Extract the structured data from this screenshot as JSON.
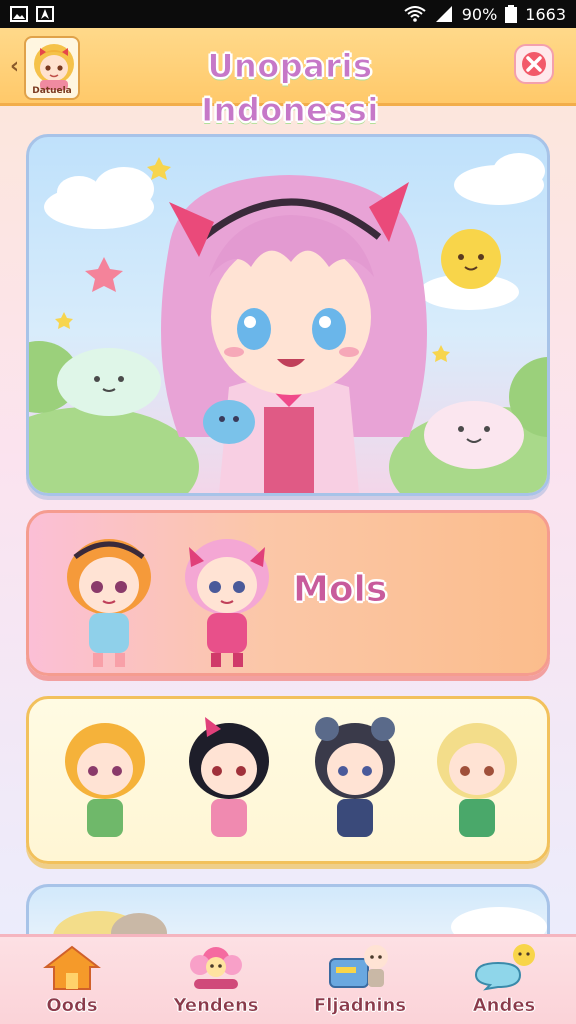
{
  "status_bar": {
    "battery": "90%",
    "time": "1663"
  },
  "header": {
    "title": "Unoparis Indonessi",
    "avatar_label": "Datuela"
  },
  "cards": {
    "moms_label": "Mols"
  },
  "bottom_nav": {
    "items": [
      {
        "label": "Oods",
        "icon": "home-icon"
      },
      {
        "label": "Yendens",
        "icon": "flower-character-icon"
      },
      {
        "label": "Fljadnins",
        "icon": "card-character-icon"
      },
      {
        "label": "Andes",
        "icon": "chat-character-icon"
      }
    ]
  },
  "colors": {
    "header_bg": "#ffc96a",
    "title": "#c678c8",
    "moms_card": "#fbbd8c",
    "group_card": "#fff6d4",
    "nav_bg": "#fbd3d8"
  }
}
